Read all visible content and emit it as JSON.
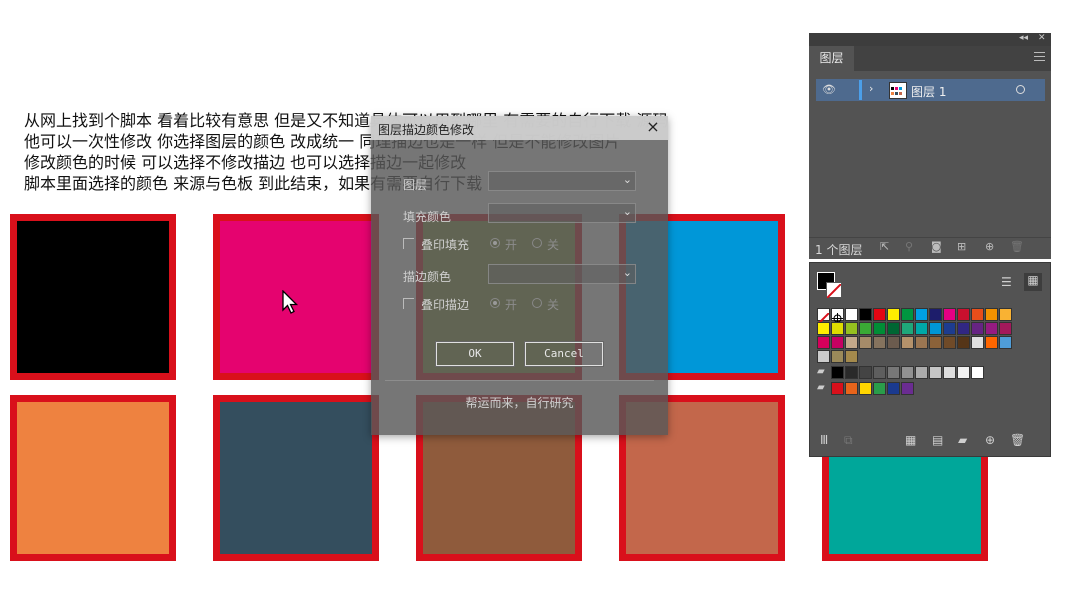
{
  "note": {
    "lines": [
      "从网上找到个脚本 看着比较有意思 但是又不知道具体可以用到哪里 有需要的自行下载 源码",
      "他可以一次性修改 你选择图层的颜色 改成统一 同理描边也是一样 但是不能修改图片",
      "修改颜色的时候 可以选择不修改描边 也可以选择描边一起修改",
      "脚本里面选择的颜色 来源与色板   到此结束，如果有需要自行下载"
    ]
  },
  "squares": {
    "stroke_color": "#d9101b",
    "fills": [
      "#000000",
      "#e5036f",
      "#8a9a3c",
      "#0097d8",
      "#ee8240",
      "#344e5e",
      "#8f5b3c",
      "#c3674b",
      "#00a79a"
    ]
  },
  "dialog": {
    "title": "图层描边颜色修改",
    "close": "×",
    "layer_label": "图层",
    "fill_color_label": "填充颜色",
    "overprint_fill_label": "叠印填充",
    "stroke_color_label": "描边颜色",
    "overprint_stroke_label": "叠印描边",
    "on_label": "开",
    "off_label": "关",
    "ok_label": "OK",
    "cancel_label": "Cancel",
    "footer": "帮运而来，自行研究"
  },
  "layers_panel": {
    "tab_label": "图层",
    "layer_name": "图层 1",
    "layer_count": "1 个图层"
  },
  "swatches_panel": {
    "rows": [
      [
        "none",
        "reg",
        "#ffffff",
        "#000000",
        "#e30613",
        "#ffed00",
        "#009640",
        "#00a0e3",
        "#1d1d6b",
        "#e50083",
        "#c8102e",
        "#e84e1b",
        "#f39200",
        "#f9b233"
      ],
      [
        "#ffed00",
        "#dedc00",
        "#95c11f",
        "#3aaa35",
        "#008d36",
        "#006633",
        "#1fa77a",
        "#00a8a8",
        "#0096d6",
        "#1d3c8f",
        "#312783",
        "#662483",
        "#951b81",
        "#a3195b"
      ],
      [
        "#d6005b",
        "#c60062",
        "#c4a98a",
        "#a58b69",
        "#85735e",
        "#6b5b4e",
        "#b5926b",
        "#9b7652",
        "#8b6239",
        "#6f4a28",
        "#553518",
        "#e0e0e0",
        "#ff6600",
        "#4f9dd8"
      ],
      [
        "#cccccc",
        "#9b8a5a",
        "#a48a4c"
      ],
      [
        "#000000",
        "#2a2a2a",
        "#444444",
        "#5e5e5e",
        "#777777",
        "#919191",
        "#ababab",
        "#c5c5c5",
        "#dddddd",
        "#f0f0f0",
        "#ffffff"
      ],
      [
        "#d9101b",
        "#e8641b",
        "#ffd500",
        "#2a9d4a",
        "#1b3a8f",
        "#6a2c91"
      ]
    ]
  }
}
